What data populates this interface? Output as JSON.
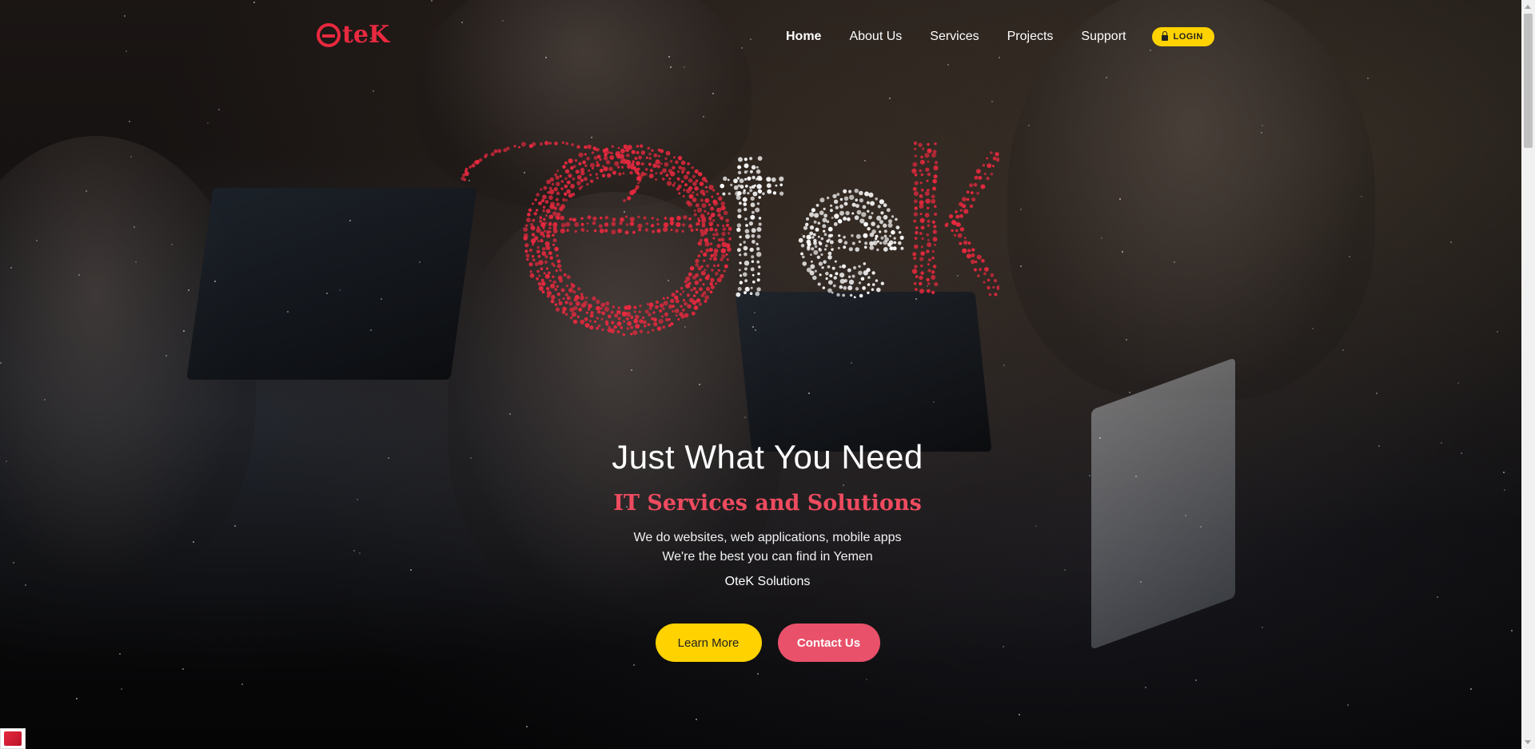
{
  "brand": {
    "logo_text_te": "te",
    "logo_text_k": "K",
    "logo_color": "#e8293f"
  },
  "nav": {
    "items": [
      {
        "label": "Home",
        "active": true
      },
      {
        "label": "About Us",
        "active": false
      },
      {
        "label": "Services",
        "active": false
      },
      {
        "label": "Projects",
        "active": false
      },
      {
        "label": "Support",
        "active": false
      }
    ],
    "login_label": "LOGIN",
    "login_icon": "lock-icon",
    "login_color": "#ffd200"
  },
  "hero": {
    "particle_logo_letters": "OteK",
    "title": "Just What You Need",
    "subtitle": "IT Services and Solutions",
    "subtitle_color": "#ee4b5f",
    "desc_line1": "We do websites, web applications, mobile apps",
    "desc_line2": "We're the best you can find in Yemen",
    "brand_line": "OteK Solutions"
  },
  "cta": {
    "learn_more": "Learn More",
    "contact_us": "Contact Us",
    "learn_more_color": "#ffd200",
    "contact_us_color": "#e9516a"
  }
}
